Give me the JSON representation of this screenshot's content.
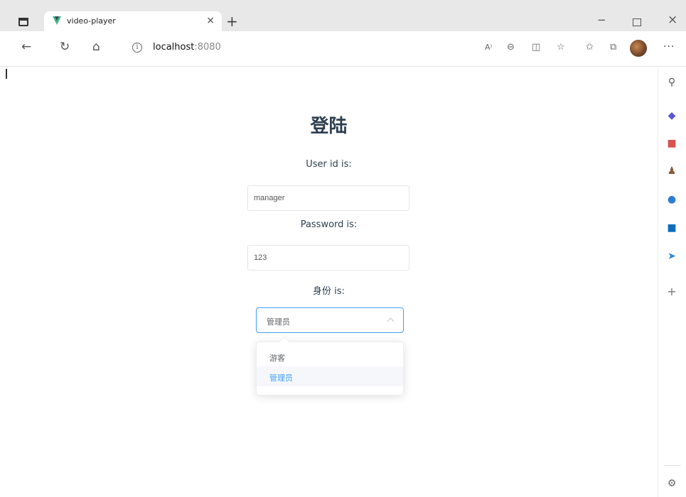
{
  "browser": {
    "tab_title": "video-player",
    "tab_close": "×",
    "new_tab": "+",
    "minimize": "−",
    "close": "×",
    "url_host": "localhost",
    "url_port": ":8080",
    "more": "···"
  },
  "form": {
    "title": "登陆",
    "user_label": "User id is:",
    "user_value": "manager",
    "password_label": "Password is:",
    "password_value": "123",
    "role_label": "身份 is:",
    "role_value": "管理员",
    "role_options": [
      "游客",
      "管理员"
    ],
    "selected_option_index": 1
  },
  "colors": {
    "accent": "#409eff",
    "title_text": "#2c3e50",
    "vue_logo_green": "#42b883"
  },
  "icons": {
    "toolbar": [
      "back-icon",
      "reload-icon",
      "home-icon",
      "info-icon",
      "read-aloud-icon",
      "zoom-icon",
      "reader-icon",
      "add-favorite-icon",
      "favorites-icon",
      "collections-icon"
    ],
    "sidebar": [
      "search-icon",
      "tag-icon",
      "shopping-bag-icon",
      "people-icon",
      "office-icon",
      "outlook-icon",
      "send-icon",
      "add-icon",
      "gear-icon"
    ]
  }
}
